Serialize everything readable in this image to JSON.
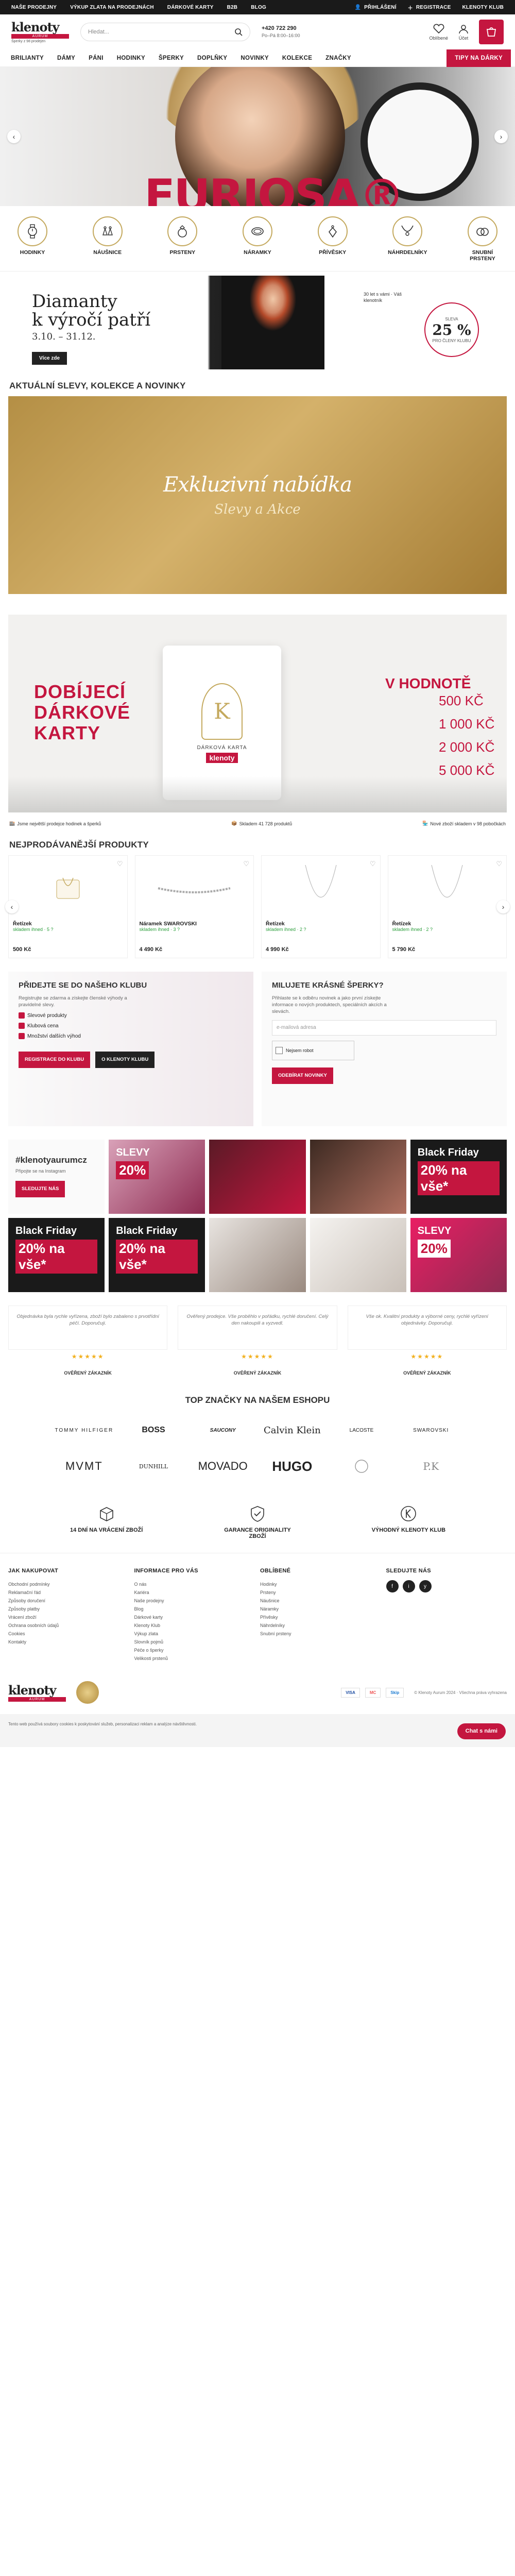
{
  "topbar": {
    "links": [
      "NAŠE PRODEJNY",
      "VÝKUP ZLATA NA PRODEJNÁCH",
      "DÁRKOVÉ KARTY",
      "B2B",
      "BLOG"
    ],
    "login": "PŘIHLÁŠENÍ",
    "register": "REGISTRACE",
    "club": "KLENOTY KLUB"
  },
  "header": {
    "logo_main": "klenoty",
    "logo_sub": "AURUM",
    "logo_tag": "Šperky z 98 prodejen",
    "search_placeholder": "Hledat...",
    "phone": "+420 722 290",
    "phone_hours": "Po–Pá 8:00–16:00",
    "wishlist": "Oblíbené",
    "account": "Účet",
    "cart": "Košík"
  },
  "nav": {
    "items": [
      "BRILIANTY",
      "DÁMY",
      "PÁNI",
      "HODINKY",
      "ŠPERKY",
      "DOPLŇKY",
      "NOVINKY",
      "KOLEKCE",
      "ZNAČKY"
    ],
    "highlight": "TIPY NA DÁRKY"
  },
  "hero": {
    "brand": "FURIOSA®"
  },
  "categories": [
    {
      "label": "HODINKY",
      "icon": "watch-icon"
    },
    {
      "label": "NÁUŠNICE",
      "icon": "earrings-icon"
    },
    {
      "label": "PRSTENY",
      "icon": "ring-icon"
    },
    {
      "label": "NÁRAMKY",
      "icon": "bracelet-icon"
    },
    {
      "label": "PŘÍVĚSKY",
      "icon": "pendant-icon"
    },
    {
      "label": "NÁHRDELNÍKY",
      "icon": "necklace-icon"
    },
    {
      "label": "SNUBNÍ PRSTENY",
      "icon": "wedding-rings-icon"
    }
  ],
  "diamond_banner": {
    "title_1": "Diamanty",
    "title_2": "k výročí patří",
    "dates": "3.10. – 31.12.",
    "button": "Více zde",
    "heart_text": "30 let s vámi · Váš klenotník",
    "discount": "25 %",
    "discount_label": "SLEVA",
    "discount_sub": "PRO ČLENY KLUBU"
  },
  "section_titles": {
    "news": "AKTUÁLNÍ SLEVY, KOLEKCE A NOVINKY",
    "bestsellers": "NEJPRODÁVANĚJŠÍ PRODUKTY",
    "brands": "TOP ZNAČKY NA NAŠEM ESHOPU"
  },
  "gold_banner": {
    "title": "Exkluzivní nabídka",
    "subtitle": "Slevy a Akce"
  },
  "giftcard_banner": {
    "left": "DOBÍJECÍ DÁRKOVÉ KARTY",
    "card_label": "DÁRKOVÁ KARTA",
    "card_brand": "klenoty",
    "values_title": "V HODNOTĚ",
    "values": [
      "500 KČ",
      "1 000 KČ",
      "2 000 KČ",
      "5 000 KČ"
    ]
  },
  "benefits": [
    "Jsme největší prodejce hodinek a šperků",
    "Skladem 41 728 produktů",
    "Nové zboží skladem v 98 pobočkách"
  ],
  "products": [
    {
      "name": "Řetízek",
      "avail": "skladem ihned · 5 ?",
      "price": "500 Kč"
    },
    {
      "name": "Náramek SWAROVSKI",
      "avail": "skladem ihned · 3 ?",
      "price": "4 490 Kč"
    },
    {
      "name": "Řetízek",
      "avail": "skladem ihned · 2 ?",
      "price": "4 990 Kč"
    },
    {
      "name": "Řetízek",
      "avail": "skladem ihned · 2 ?",
      "price": "5 790 Kč"
    }
  ],
  "club": {
    "title": "PŘIDEJTE SE DO NAŠEHO KLUBU",
    "text": "Registrujte se zdarma a získejte členské výhody a pravidelné slevy.",
    "perks": [
      "Slevové produkty",
      "Klubová cena",
      "Množství dalších výhod"
    ],
    "btn_register": "REGISTRACE DO KLUBU",
    "btn_more": "O KLENOTY KLUBU"
  },
  "newsletter": {
    "title": "MILUJETE KRÁSNÉ ŠPERKY?",
    "text": "Přihlaste se k odběru novinek a jako první získejte informace o nových produktech, speciálních akcích a slevách.",
    "email_placeholder": "e-mailová adresa",
    "captcha": "Nejsem robot",
    "btn": "ODEBÍRAT NOVINKY"
  },
  "insta": {
    "handle": "#klenotyaurumcz",
    "text": "Připojte se na Instagram",
    "btn": "SLEDUJTE NÁS",
    "tiles": [
      {
        "t": "",
        "s": ""
      },
      {
        "t": "SLEVY",
        "s": "20%"
      },
      {
        "t": "",
        "s": ""
      },
      {
        "t": "Black Friday",
        "s": "20% na vše*"
      },
      {
        "t": "Black Friday",
        "s": "20% na vše*"
      },
      {
        "t": "Black Friday",
        "s": "20% na vše*"
      },
      {
        "t": "",
        "s": ""
      },
      {
        "t": "",
        "s": ""
      },
      {
        "t": "SLEVY",
        "s": "20%"
      }
    ]
  },
  "reviews": [
    {
      "text": "Objednávka byla rychle vyřízena, zboží bylo zabaleno s prvotřídní péčí. Doporučuji.",
      "stars": "★★★★★",
      "name": "OVĚŘENÝ ZÁKAZNÍK"
    },
    {
      "text": "Ověřený prodejce. Vše proběhlo v pořádku, rychlé doručení. Celý den nakoupili a vyzvedl.",
      "stars": "★★★★★",
      "name": "OVĚŘENÝ ZÁKAZNÍK"
    },
    {
      "text": "Vše ok. Kvalitní produkty a výborné ceny, rychlé vyřízení objednávky. Doporučuji.",
      "stars": "★★★★★",
      "name": "OVĚŘENÝ ZÁKAZNÍK"
    }
  ],
  "brands": [
    "TOMMY HILFIGER",
    "BOSS",
    "SAUCONY",
    "Calvin Klein",
    "LACOSTE",
    "SWAROVSKI",
    "MVMT",
    "DUNHILL",
    "MOVADO",
    "HUGO",
    "",
    "P.K"
  ],
  "usps": [
    "14 DNÍ NA VRÁCENÍ ZBOŽÍ",
    "GARANCE ORIGINALITY ZBOŽÍ",
    "VÝHODNÝ KLENOTY KLUB"
  ],
  "footer": {
    "columns": [
      {
        "title": "JAK NAKUPOVAT",
        "links": [
          "Obchodní podmínky",
          "Reklamační řád",
          "Způsoby doručení",
          "Způsoby platby",
          "Vrácení zboží",
          "Ochrana osobních údajů",
          "Cookies",
          "Kontakty"
        ]
      },
      {
        "title": "INFORMACE PRO VÁS",
        "links": [
          "O nás",
          "Kariéra",
          "Naše prodejny",
          "Blog",
          "Dárkové karty",
          "Klenoty Klub",
          "Výkup zlata",
          "Slovník pojmů",
          "Péče o šperky",
          "Velikosti prstenů"
        ]
      },
      {
        "title": "OBLÍBENÉ",
        "links": [
          "Hodinky",
          "Prsteny",
          "Náušnice",
          "Náramky",
          "Přívěsky",
          "Náhrdelníky",
          "Snubní prsteny"
        ]
      },
      {
        "title": "SLEDUJTE NÁS",
        "links": []
      }
    ],
    "social": [
      "f",
      "i",
      "y"
    ],
    "copyright": "© Klenoty Aurum 2024 · Všechna práva vyhrazena"
  },
  "cookie": {
    "text": "Tento web používá soubory cookies k poskytování služeb, personalizaci reklam a analýze návštěvnosti."
  },
  "chat": {
    "label": "Chat s námi"
  }
}
